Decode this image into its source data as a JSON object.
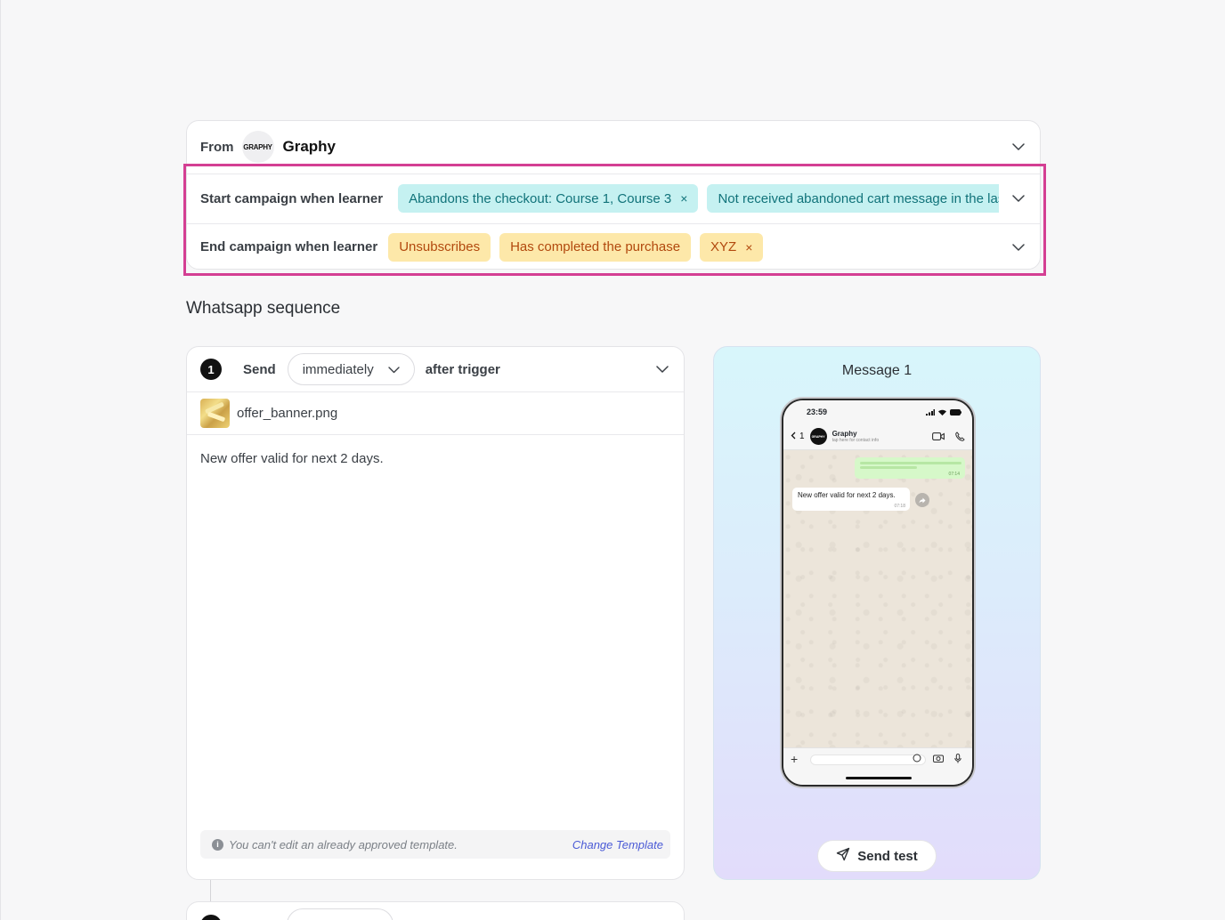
{
  "campaign": {
    "from_label": "From",
    "from_avatar_text": "GRAPHY",
    "from_name": "Graphy",
    "start_label": "Start campaign when learner",
    "start_chips": [
      "Abandons the checkout: Course 1, Course 3",
      "Not received abandoned cart message in the last"
    ],
    "end_label": "End campaign when learner",
    "end_chips": [
      "Unsubscribes",
      "Has completed the purchase",
      "XYZ"
    ],
    "remove_symbol": "×"
  },
  "sequence": {
    "title": "Whatsapp sequence",
    "step_number": "1",
    "send_label": "Send",
    "timing_value": "immediately",
    "after_label": "after trigger",
    "attachment_name": "offer_banner.png",
    "message_text": "New offer valid for next 2 days.",
    "notice_icon": "i",
    "notice_text": "You can't edit an already approved template.",
    "change_template_label": "Change Template"
  },
  "preview": {
    "title": "Message 1",
    "status_time": "23:59",
    "back_count": "1",
    "chat_avatar_text": "GRAPHY",
    "chat_name": "Graphy",
    "chat_subtitle": "tap here for contact info",
    "outgoing_time": "07:14",
    "incoming_text": "New offer valid for next 2 days.",
    "incoming_time": "07:18",
    "send_test_label": "Send test"
  },
  "colors": {
    "accent_teal": "#11737a",
    "chip_amber_text": "#b2490e",
    "highlight": "#d43f93",
    "link": "#4b5bd6"
  }
}
